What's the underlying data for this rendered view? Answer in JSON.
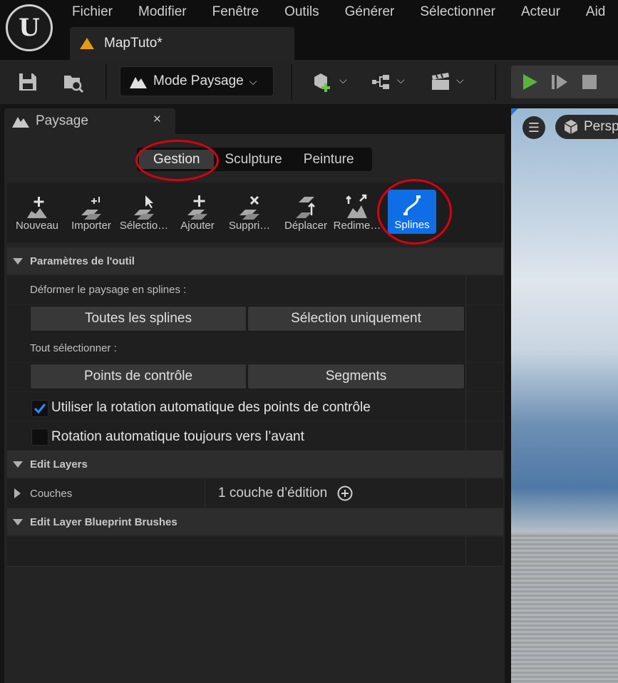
{
  "app": {
    "logo_text": "U",
    "menu": [
      "Fichier",
      "Modifier",
      "Fenêtre",
      "Outils",
      "Générer",
      "Sélectionner",
      "Acteur",
      "Aid"
    ],
    "document_tab": "MapTuto*"
  },
  "toolbar": {
    "mode_dropdown": "Mode Paysage",
    "icons": [
      "save-icon",
      "browse-icon",
      "add-actor-icon",
      "blueprint-icon",
      "cinematics-icon",
      "play-icon",
      "skip-icon",
      "stop-icon"
    ],
    "colors": {
      "play": "#5ab43c",
      "add": "#6cc24a",
      "accent": "#0f6ee6",
      "map_tab_icon": "#e59a12"
    }
  },
  "panel": {
    "title": "Paysage",
    "close": "×",
    "modes": [
      "Gestion",
      "Sculpture",
      "Peinture"
    ],
    "active_mode": "Gestion",
    "tools": [
      "Nouveau",
      "Importer",
      "Sélectio…",
      "Ajouter",
      "Suppri…",
      "Déplacer",
      "Redime…",
      "Splines"
    ],
    "active_tool": "Splines",
    "tool_settings": {
      "header": "Paramètres de l'outil",
      "deform_label": "Déformer le paysage en splines :",
      "deform_all": "Toutes les splines",
      "deform_selected": "Sélection uniquement",
      "select_all_label": "Tout sélectionner :",
      "select_points": "Points de contrôle",
      "select_segments": "Segments",
      "auto_rotation_label": "Utiliser la rotation automatique des points de contrôle",
      "auto_rotation_checked": true,
      "forward_rotation_label": "Rotation automatique toujours vers l’avant",
      "forward_rotation_checked": false
    },
    "edit_layers": {
      "header": "Edit Layers",
      "couches_label": "Couches",
      "couches_value": "1 couche d’édition"
    },
    "blueprint_brushes": {
      "header": "Edit Layer Blueprint Brushes"
    }
  },
  "viewport": {
    "view_label": "Persp"
  }
}
